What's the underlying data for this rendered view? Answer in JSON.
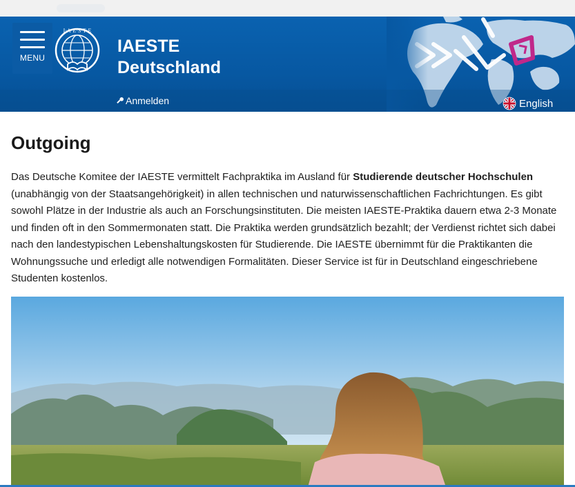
{
  "header": {
    "menu_label": "MENU",
    "site_name_line1": "IAESTE",
    "site_name_line2": "Deutschland",
    "login_label": "Anmelden",
    "language_label": "English",
    "logo_ring_text": "I·A·E·S·T·E",
    "colors": {
      "header_blue": "#0758a2",
      "accent_magenta": "#c0288a"
    }
  },
  "main": {
    "title": "Outgoing",
    "intro_part1": "Das Deutsche Komitee der IAESTE vermittelt Fachpraktika im Ausland für ",
    "intro_bold": "Studierende deutscher Hochschulen",
    "intro_part2": " (unabhängig von der Staatsangehörigkeit) in allen technischen und naturwissenschaftlichen Fachrichtungen. Es gibt sowohl Plätze in der Industrie als auch an Forschungsinstituten. Die meisten IAESTE-Praktika dauern etwa 2-3 Monate und finden oft in den Sommermonaten statt. Die Praktika werden grundsätzlich bezahlt; der Verdienst richtet sich dabei nach den landestypischen Lebenshaltungskosten für Studierende. Die IAESTE übernimmt für die Praktikanten die Wohnungssuche und erledigt alle notwendigen Formalitäten. Dieser Service ist für in Deutschland eingeschriebene Studenten kostenlos."
  },
  "icons": {
    "menu": "hamburger-icon",
    "login": "key-icon",
    "language": "uk-flag-icon"
  }
}
